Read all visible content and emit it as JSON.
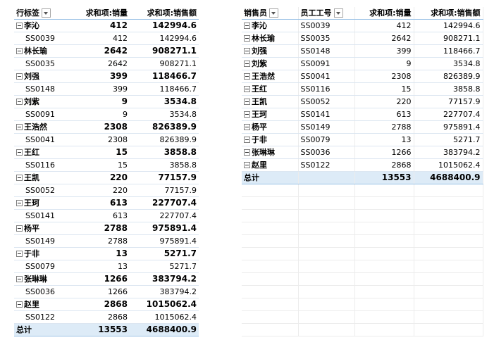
{
  "pivot1": {
    "headers": {
      "row_label": "行标签",
      "qty": "求和项:销量",
      "sales": "求和项:销售额"
    },
    "groups": [
      {
        "name": "李沁",
        "qty": "412",
        "sales": "142994.6",
        "id": "SS0039",
        "dqty": "412",
        "dsales": "142994.6"
      },
      {
        "name": "林长瑜",
        "qty": "2642",
        "sales": "908271.1",
        "id": "SS0035",
        "dqty": "2642",
        "dsales": "908271.1"
      },
      {
        "name": "刘强",
        "qty": "399",
        "sales": "118466.7",
        "id": "SS0148",
        "dqty": "399",
        "dsales": "118466.7"
      },
      {
        "name": "刘紫",
        "qty": "9",
        "sales": "3534.8",
        "id": "SS0091",
        "dqty": "9",
        "dsales": "3534.8"
      },
      {
        "name": "王浩然",
        "qty": "2308",
        "sales": "826389.9",
        "id": "SS0041",
        "dqty": "2308",
        "dsales": "826389.9"
      },
      {
        "name": "王红",
        "qty": "15",
        "sales": "3858.8",
        "id": "SS0116",
        "dqty": "15",
        "dsales": "3858.8"
      },
      {
        "name": "王凯",
        "qty": "220",
        "sales": "77157.9",
        "id": "SS0052",
        "dqty": "220",
        "dsales": "77157.9"
      },
      {
        "name": "王珂",
        "qty": "613",
        "sales": "227707.4",
        "id": "SS0141",
        "dqty": "613",
        "dsales": "227707.4"
      },
      {
        "name": "杨平",
        "qty": "2788",
        "sales": "975891.4",
        "id": "SS0149",
        "dqty": "2788",
        "dsales": "975891.4"
      },
      {
        "name": "于非",
        "qty": "13",
        "sales": "5271.7",
        "id": "SS0079",
        "dqty": "13",
        "dsales": "5271.7"
      },
      {
        "name": "张琳琳",
        "qty": "1266",
        "sales": "383794.2",
        "id": "SS0036",
        "dqty": "1266",
        "dsales": "383794.2"
      },
      {
        "name": "赵里",
        "qty": "2868",
        "sales": "1015062.4",
        "id": "SS0122",
        "dqty": "2868",
        "dsales": "1015062.4"
      }
    ],
    "total": {
      "label": "总计",
      "qty": "13553",
      "sales": "4688400.9"
    }
  },
  "pivot2": {
    "headers": {
      "seller": "销售员",
      "emp_id": "员工工号",
      "qty": "求和项:销量",
      "sales": "求和项:销售额"
    },
    "rows": [
      {
        "name": "李沁",
        "id": "SS0039",
        "qty": "412",
        "sales": "142994.6"
      },
      {
        "name": "林长瑜",
        "id": "SS0035",
        "qty": "2642",
        "sales": "908271.1"
      },
      {
        "name": "刘强",
        "id": "SS0148",
        "qty": "399",
        "sales": "118466.7"
      },
      {
        "name": "刘紫",
        "id": "SS0091",
        "qty": "9",
        "sales": "3534.8"
      },
      {
        "name": "王浩然",
        "id": "SS0041",
        "qty": "2308",
        "sales": "826389.9"
      },
      {
        "name": "王红",
        "id": "SS0116",
        "qty": "15",
        "sales": "3858.8"
      },
      {
        "name": "王凯",
        "id": "SS0052",
        "qty": "220",
        "sales": "77157.9"
      },
      {
        "name": "王珂",
        "id": "SS0141",
        "qty": "613",
        "sales": "227707.4"
      },
      {
        "name": "杨平",
        "id": "SS0149",
        "qty": "2788",
        "sales": "975891.4"
      },
      {
        "name": "于非",
        "id": "SS0079",
        "qty": "13",
        "sales": "5271.7"
      },
      {
        "name": "张琳琳",
        "id": "SS0036",
        "qty": "1266",
        "sales": "383794.2"
      },
      {
        "name": "赵里",
        "id": "SS0122",
        "qty": "2868",
        "sales": "1015062.4"
      }
    ],
    "total": {
      "label": "总计",
      "qty": "13553",
      "sales": "4688400.9"
    }
  }
}
